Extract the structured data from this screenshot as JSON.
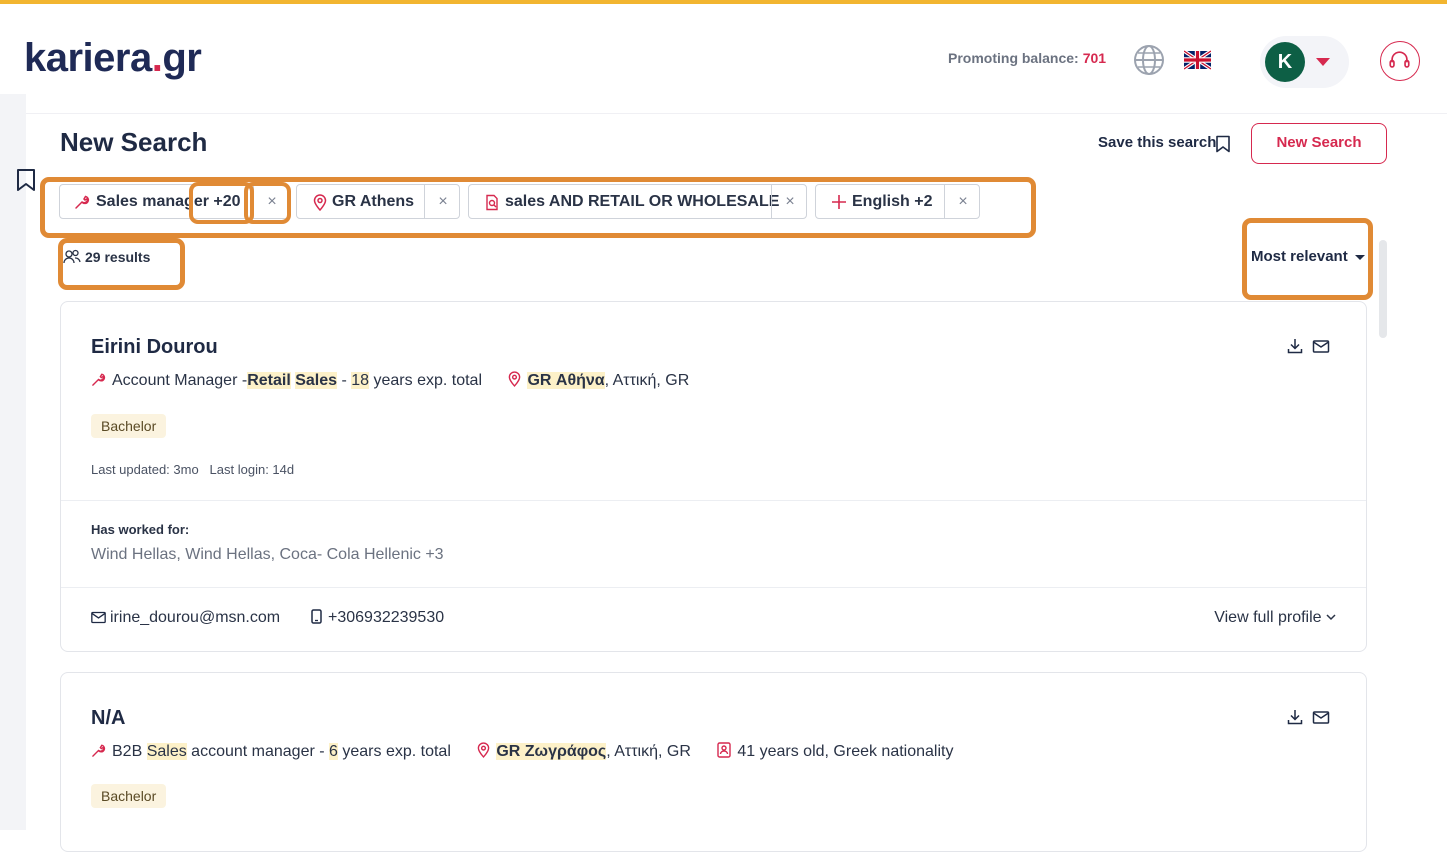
{
  "header": {
    "logo_text": "kariera",
    "logo_dot": ".",
    "logo_tld": "gr",
    "promo_label": "Promoting balance:",
    "promo_value": "701",
    "avatar_initial": "K"
  },
  "colors": {
    "brand": "#d6294f",
    "navy": "#1f2a56",
    "avatar": "#0d5f45",
    "highlight": "#fdf1c8",
    "annotation": "#e08a35"
  },
  "page": {
    "title": "New Search",
    "save_search_label": "Save this search",
    "new_search_button": "New Search"
  },
  "filters": [
    {
      "label": "Sales manager +20",
      "icon": "wrench-icon"
    },
    {
      "label": "GR Athens",
      "icon": "location-pin-icon"
    },
    {
      "label": "sales AND RETAIL OR WHOLESALE",
      "icon": "search-doc-icon"
    },
    {
      "label": "English +2",
      "icon": "plus-icon"
    }
  ],
  "results": {
    "count_label": "29 results",
    "sort_label": "Most relevant"
  },
  "candidates": [
    {
      "name": "Eirini Dourou",
      "title_pre": "Account Manager -",
      "title_hl1": "Retail",
      "title_hl2": "Sales",
      "title_dash": " - ",
      "years": "18",
      "years_suffix": " years exp. total",
      "loc_hl": "GR Αθήνα",
      "loc_rest": ", Αττική, GR",
      "education": "Bachelor",
      "last_updated": "Last updated: 3mo",
      "last_login": "Last login: 14d",
      "worked_label": "Has worked for:",
      "worked_for": "Wind Hellas, Wind Hellas, Coca- Cola Hellenic +3",
      "email": "irine_dourou@msn.com",
      "phone": "+306932239530",
      "view_profile": "View full profile"
    },
    {
      "name": "N/A",
      "title_pre": "B2B ",
      "title_hl": "Sales",
      "title_post": " account manager - ",
      "years": "6",
      "years_suffix": " years exp. total",
      "loc_hl": "GR Ζωγράφος",
      "loc_rest": ", Αττική, GR",
      "extra": "41 years old, Greek nationality",
      "education": "Bachelor"
    }
  ]
}
